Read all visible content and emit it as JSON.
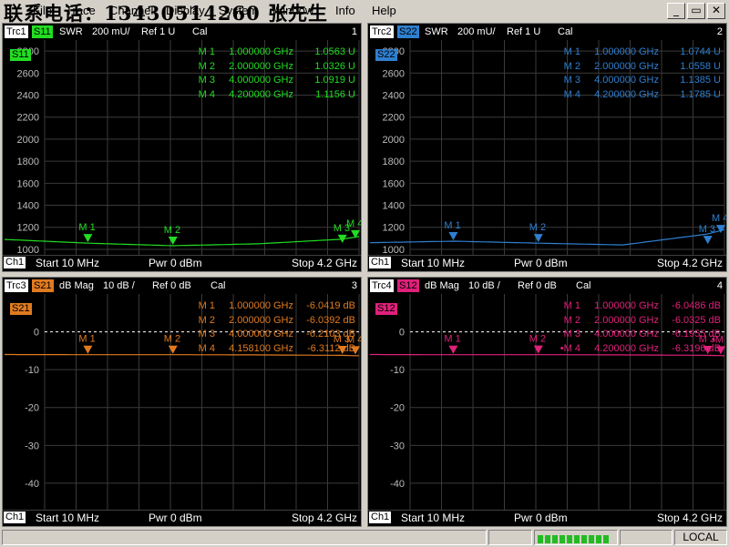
{
  "window": {
    "watermark": "联系电话：13430514260 张先生",
    "menu": [
      "File",
      "Trace",
      "Channel",
      "Display",
      "System",
      "Window",
      "Info",
      "Help"
    ],
    "controls": [
      "_",
      "▭",
      "✕"
    ]
  },
  "panels": [
    {
      "trace": "Trc1",
      "param": "S11",
      "format": "SWR",
      "scale": "200 mU/",
      "ref": "Ref 1 U",
      "cal": "Cal",
      "index": "1",
      "color": "#22dd22",
      "channel": "Ch1",
      "start": "Start  10 MHz",
      "pwr": "Pwr  0 dBm",
      "stop": "Stop  4.2 GHz",
      "markers": [
        {
          "name": "M 1",
          "freq": "1.000000 GHz",
          "value": "1.0563 U"
        },
        {
          "name": "M 2",
          "freq": "2.000000 GHz",
          "value": "1.0326 U"
        },
        {
          "name": "M 3",
          "freq": "4.000000 GHz",
          "value": "1.0919 U"
        },
        {
          "name": "M 4",
          "freq": "4.200000 GHz",
          "value": "1.1156 U"
        }
      ],
      "y_ticks": [
        "2800",
        "2600",
        "2400",
        "2200",
        "2000",
        "1800",
        "1600",
        "1400",
        "1200",
        "1000"
      ],
      "chart_data": {
        "type": "line",
        "x_unit": "GHz",
        "x": [
          0.01,
          1.0,
          2.0,
          3.0,
          4.0,
          4.2
        ],
        "y": [
          1.09,
          1.056,
          1.033,
          1.05,
          1.092,
          1.116
        ],
        "ylim": [
          1.0,
          2.8
        ],
        "xlim": [
          0.01,
          4.2
        ]
      }
    },
    {
      "trace": "Trc2",
      "param": "S22",
      "format": "SWR",
      "scale": "200 mU/",
      "ref": "Ref 1 U",
      "cal": "Cal",
      "index": "2",
      "color": "#2f7fd0",
      "channel": "Ch1",
      "start": "Start  10 MHz",
      "pwr": "Pwr  0 dBm",
      "stop": "Stop  4.2 GHz",
      "markers": [
        {
          "name": "M 1",
          "freq": "1.000000 GHz",
          "value": "1.0744 U"
        },
        {
          "name": "M 2",
          "freq": "2.000000 GHz",
          "value": "1.0558 U"
        },
        {
          "name": "M 3",
          "freq": "4.000000 GHz",
          "value": "1.1385 U"
        },
        {
          "name": "M 4",
          "freq": "4.200000 GHz",
          "value": "1.1785 U"
        }
      ],
      "y_ticks": [
        "2800",
        "2600",
        "2400",
        "2200",
        "2000",
        "1800",
        "1600",
        "1400",
        "1200",
        "1000"
      ],
      "chart_data": {
        "type": "line",
        "x_unit": "GHz",
        "x": [
          0.01,
          1.0,
          2.0,
          3.0,
          4.0,
          4.2
        ],
        "y": [
          1.06,
          1.074,
          1.056,
          1.04,
          1.139,
          1.179
        ],
        "ylim": [
          1.0,
          2.8
        ],
        "xlim": [
          0.01,
          4.2
        ]
      }
    },
    {
      "trace": "Trc3",
      "param": "S21",
      "format": "dB Mag",
      "scale": "10 dB /",
      "ref": "Ref 0 dB",
      "cal": "Cal",
      "index": "3",
      "color": "#e07a20",
      "channel": "Ch1",
      "start": "Start  10 MHz",
      "pwr": "Pwr  0 dBm",
      "stop": "Stop  4.2 GHz",
      "markers": [
        {
          "name": "M 1",
          "freq": "1.000000 GHz",
          "value": "-6.0419 dB"
        },
        {
          "name": "M 2",
          "freq": "2.000000 GHz",
          "value": "-6.0392 dB"
        },
        {
          "name": "M 3",
          "freq": "4.000000 GHz",
          "value": "-6.2103 dB"
        },
        {
          "name": "M 4",
          "freq": "4.158100 GHz",
          "value": "-6.3112 dB"
        }
      ],
      "y_ticks": [
        "0",
        "-10",
        "-20",
        "-30",
        "-40"
      ],
      "chart_data": {
        "type": "line",
        "x_unit": "GHz",
        "x": [
          0.01,
          1.0,
          2.0,
          3.0,
          4.0,
          4.158
        ],
        "y": [
          -6.0,
          -6.04,
          -6.04,
          -6.1,
          -6.21,
          -6.31
        ],
        "ylim": [
          -45,
          0
        ],
        "xlim": [
          0.01,
          4.2
        ]
      }
    },
    {
      "trace": "Trc4",
      "param": "S12",
      "format": "dB Mag",
      "scale": "10 dB /",
      "ref": "Ref 0 dB",
      "cal": "Cal",
      "index": "4",
      "color": "#e0207a",
      "channel": "Ch1",
      "start": "Start  10 MHz",
      "pwr": "Pwr  0 dBm",
      "stop": "Stop  4.2 GHz",
      "markers": [
        {
          "name": "M 1",
          "freq": "1.000000 GHz",
          "value": "-6.0486 dB"
        },
        {
          "name": "M 2",
          "freq": "2.000000 GHz",
          "value": "-6.0325 dB"
        },
        {
          "name": "M 3",
          "freq": "4.000000 GHz",
          "value": "-6.1955 dB"
        },
        {
          "name": "•M 4",
          "freq": "4.200000 GHz",
          "value": "-6.3196 dB"
        }
      ],
      "y_ticks": [
        "0",
        "-10",
        "-20",
        "-30",
        "-40"
      ],
      "chart_data": {
        "type": "line",
        "x_unit": "GHz",
        "x": [
          0.01,
          1.0,
          2.0,
          3.0,
          4.0,
          4.2
        ],
        "y": [
          -6.0,
          -6.05,
          -6.03,
          -6.1,
          -6.2,
          -6.32
        ],
        "ylim": [
          -45,
          0
        ],
        "xlim": [
          0.01,
          4.2
        ]
      }
    }
  ],
  "status": {
    "local": "LOCAL"
  }
}
